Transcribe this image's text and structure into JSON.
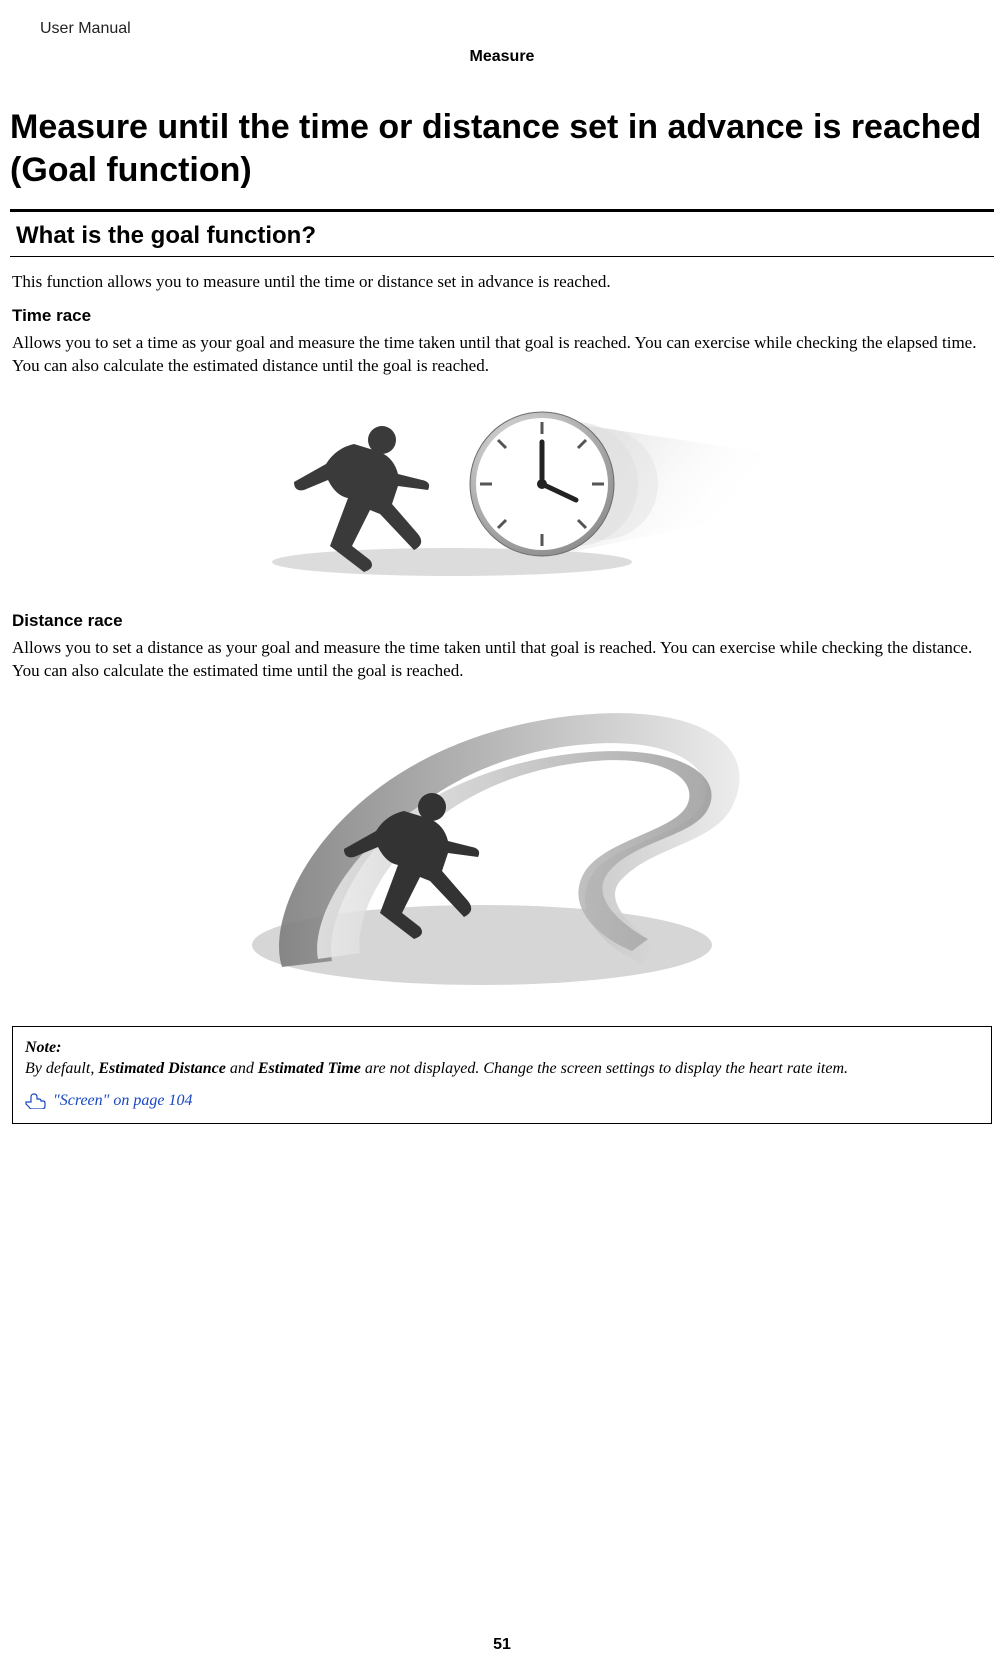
{
  "header": {
    "doc_title": "User Manual",
    "section": "Measure"
  },
  "title": "Measure until the time or distance set in advance is reached (Goal function)",
  "subheading": "What is the goal function?",
  "intro": "This function allows you to measure until the time or distance set in advance is reached.",
  "time_race": {
    "heading": "Time race",
    "body": "Allows you to set a time as your goal and measure the time taken until that goal is reached. You can exercise while checking the elapsed time. You can also calculate the estimated distance until the goal is reached."
  },
  "distance_race": {
    "heading": "Distance race",
    "body": "Allows you to set a distance as your goal and measure the time taken until that goal is reached. You can exercise while checking the distance. You can also calculate the estimated time until the goal is reached."
  },
  "note": {
    "label": "Note:",
    "prefix": "By default, ",
    "bold1": "Estimated Distance",
    "mid1": " and ",
    "bold2": "Estimated Time",
    "suffix": " are not displayed. Change the screen settings to display the heart rate item.",
    "xref": "\"Screen\" on page 104"
  },
  "page_number": "51"
}
